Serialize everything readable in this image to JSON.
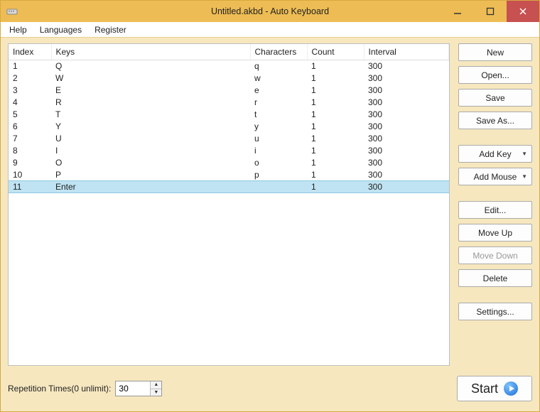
{
  "window": {
    "title": "Untitled.akbd - Auto Keyboard"
  },
  "menu": {
    "items": [
      "Help",
      "Languages",
      "Register"
    ]
  },
  "grid": {
    "columns": [
      "Index",
      "Keys",
      "Characters",
      "Count",
      "Interval"
    ],
    "rows": [
      {
        "index": "1",
        "keys": "Q",
        "chars": "q",
        "count": "1",
        "interval": "300"
      },
      {
        "index": "2",
        "keys": "W",
        "chars": "w",
        "count": "1",
        "interval": "300"
      },
      {
        "index": "3",
        "keys": "E",
        "chars": "e",
        "count": "1",
        "interval": "300"
      },
      {
        "index": "4",
        "keys": "R",
        "chars": "r",
        "count": "1",
        "interval": "300"
      },
      {
        "index": "5",
        "keys": "T",
        "chars": "t",
        "count": "1",
        "interval": "300"
      },
      {
        "index": "6",
        "keys": "Y",
        "chars": "y",
        "count": "1",
        "interval": "300"
      },
      {
        "index": "7",
        "keys": "U",
        "chars": "u",
        "count": "1",
        "interval": "300"
      },
      {
        "index": "8",
        "keys": "I",
        "chars": "i",
        "count": "1",
        "interval": "300"
      },
      {
        "index": "9",
        "keys": "O",
        "chars": "o",
        "count": "1",
        "interval": "300"
      },
      {
        "index": "10",
        "keys": "P",
        "chars": "p",
        "count": "1",
        "interval": "300"
      },
      {
        "index": "11",
        "keys": "Enter",
        "chars": "",
        "count": "1",
        "interval": "300"
      }
    ],
    "selected_index": 10
  },
  "buttons": {
    "new_": "New",
    "open_": "Open...",
    "save": "Save",
    "save_as": "Save As...",
    "add_key": "Add Key",
    "add_mouse": "Add Mouse",
    "edit": "Edit...",
    "move_up": "Move Up",
    "move_down": "Move Down",
    "delete_": "Delete",
    "settings": "Settings..."
  },
  "repetition": {
    "label": "Repetition Times(0 unlimit):",
    "value": "30"
  },
  "start": {
    "label": "Start"
  }
}
